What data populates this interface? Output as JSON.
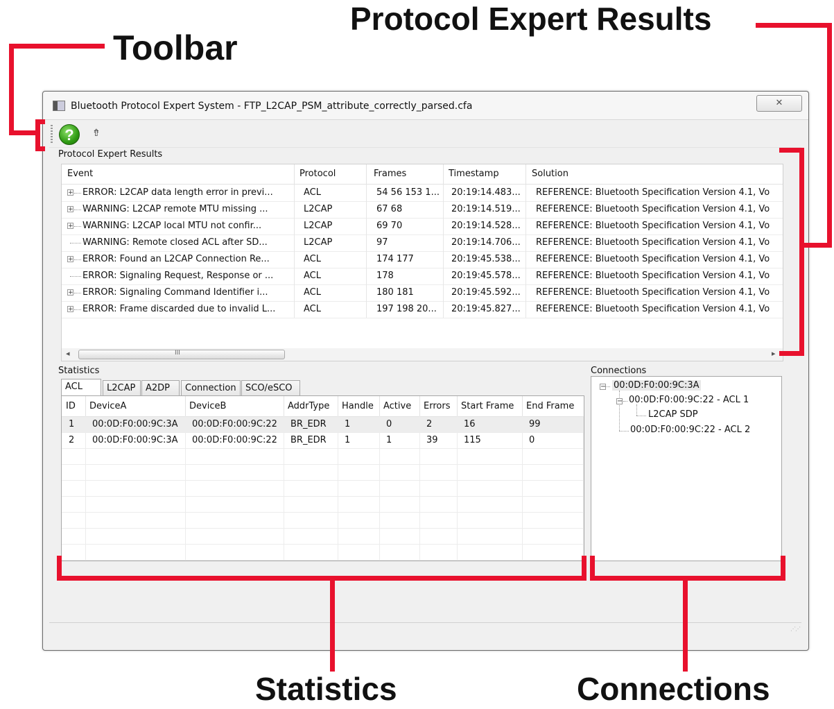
{
  "callouts": {
    "toolbar": "Toolbar",
    "results": "Protocol Expert Results",
    "statistics": "Statistics",
    "connections": "Connections"
  },
  "window": {
    "title": "Bluetooth Protocol Expert System - FTP_L2CAP_PSM_attribute_correctly_parsed.cfa",
    "close_glyph": "✕"
  },
  "toolbar": {
    "help_icon": "help-icon",
    "help_glyph": "?",
    "export_icon": "export-icon",
    "export_glyph": "⇮"
  },
  "results": {
    "label": "Protocol Expert Results",
    "columns": [
      "Event",
      "Protocol",
      "Frames",
      "Timestamp",
      "Solution"
    ],
    "rows": [
      {
        "event": "ERROR: L2CAP data length error in previ...",
        "protocol": "ACL",
        "frames": "54 56 153 1...",
        "timestamp": "20:19:14.483...",
        "solution": "REFERENCE: Bluetooth Specification Version 4.1, Vo",
        "expandable": true
      },
      {
        "event": "WARNING: L2CAP remote MTU missing ...",
        "protocol": "L2CAP",
        "frames": "67 68",
        "timestamp": "20:19:14.519...",
        "solution": "REFERENCE: Bluetooth Specification Version 4.1, Vo",
        "expandable": true
      },
      {
        "event": "WARNING: L2CAP local MTU not confir...",
        "protocol": "L2CAP",
        "frames": "69 70",
        "timestamp": "20:19:14.528...",
        "solution": "REFERENCE: Bluetooth Specification Version 4.1, Vo",
        "expandable": true
      },
      {
        "event": "WARNING: Remote closed ACL after SD...",
        "protocol": "L2CAP",
        "frames": "97",
        "timestamp": "20:19:14.706...",
        "solution": "REFERENCE: Bluetooth Specification Version 4.1, Vo",
        "expandable": false
      },
      {
        "event": "ERROR: Found an L2CAP Connection Re...",
        "protocol": "ACL",
        "frames": "174 177",
        "timestamp": "20:19:45.538...",
        "solution": "REFERENCE: Bluetooth Specification Version 4.1, Vo",
        "expandable": true
      },
      {
        "event": "ERROR: Signaling Request, Response or ...",
        "protocol": "ACL",
        "frames": "178",
        "timestamp": "20:19:45.578...",
        "solution": "REFERENCE: Bluetooth Specification Version 4.1, Vo",
        "expandable": false
      },
      {
        "event": "ERROR: Signaling Command Identifier i...",
        "protocol": "ACL",
        "frames": "180 181",
        "timestamp": "20:19:45.592...",
        "solution": "REFERENCE: Bluetooth Specification Version 4.1, Vo",
        "expandable": true
      },
      {
        "event": "ERROR: Frame discarded due to invalid L...",
        "protocol": "ACL",
        "frames": "197 198 20...",
        "timestamp": "20:19:45.827...",
        "solution": "REFERENCE: Bluetooth Specification Version 4.1, Vo",
        "expandable": true
      }
    ],
    "scroll_grip": "III"
  },
  "statistics": {
    "label": "Statistics",
    "tabs": [
      "ACL",
      "L2CAP",
      "A2DP",
      "Connection",
      "SCO/eSCO"
    ],
    "active_tab": "ACL",
    "columns": [
      "ID",
      "DeviceA",
      "DeviceB",
      "AddrType",
      "Handle",
      "Active",
      "Errors",
      "Start Frame",
      "End Frame"
    ],
    "rows": [
      [
        "1",
        "00:0D:F0:00:9C:3A",
        "00:0D:F0:00:9C:22",
        "BR_EDR",
        "1",
        "0",
        "2",
        "16",
        "99"
      ],
      [
        "2",
        "00:0D:F0:00:9C:3A",
        "00:0D:F0:00:9C:22",
        "BR_EDR",
        "1",
        "1",
        "39",
        "115",
        "0"
      ]
    ]
  },
  "connections": {
    "label": "Connections",
    "root": "00:0D:F0:00:9C:3A",
    "child1": "00:0D:F0:00:9C:22 - ACL 1",
    "grandchild": "L2CAP SDP",
    "child2": "00:0D:F0:00:9C:22 - ACL 2"
  },
  "colors": {
    "callout_red": "#e8112d"
  }
}
